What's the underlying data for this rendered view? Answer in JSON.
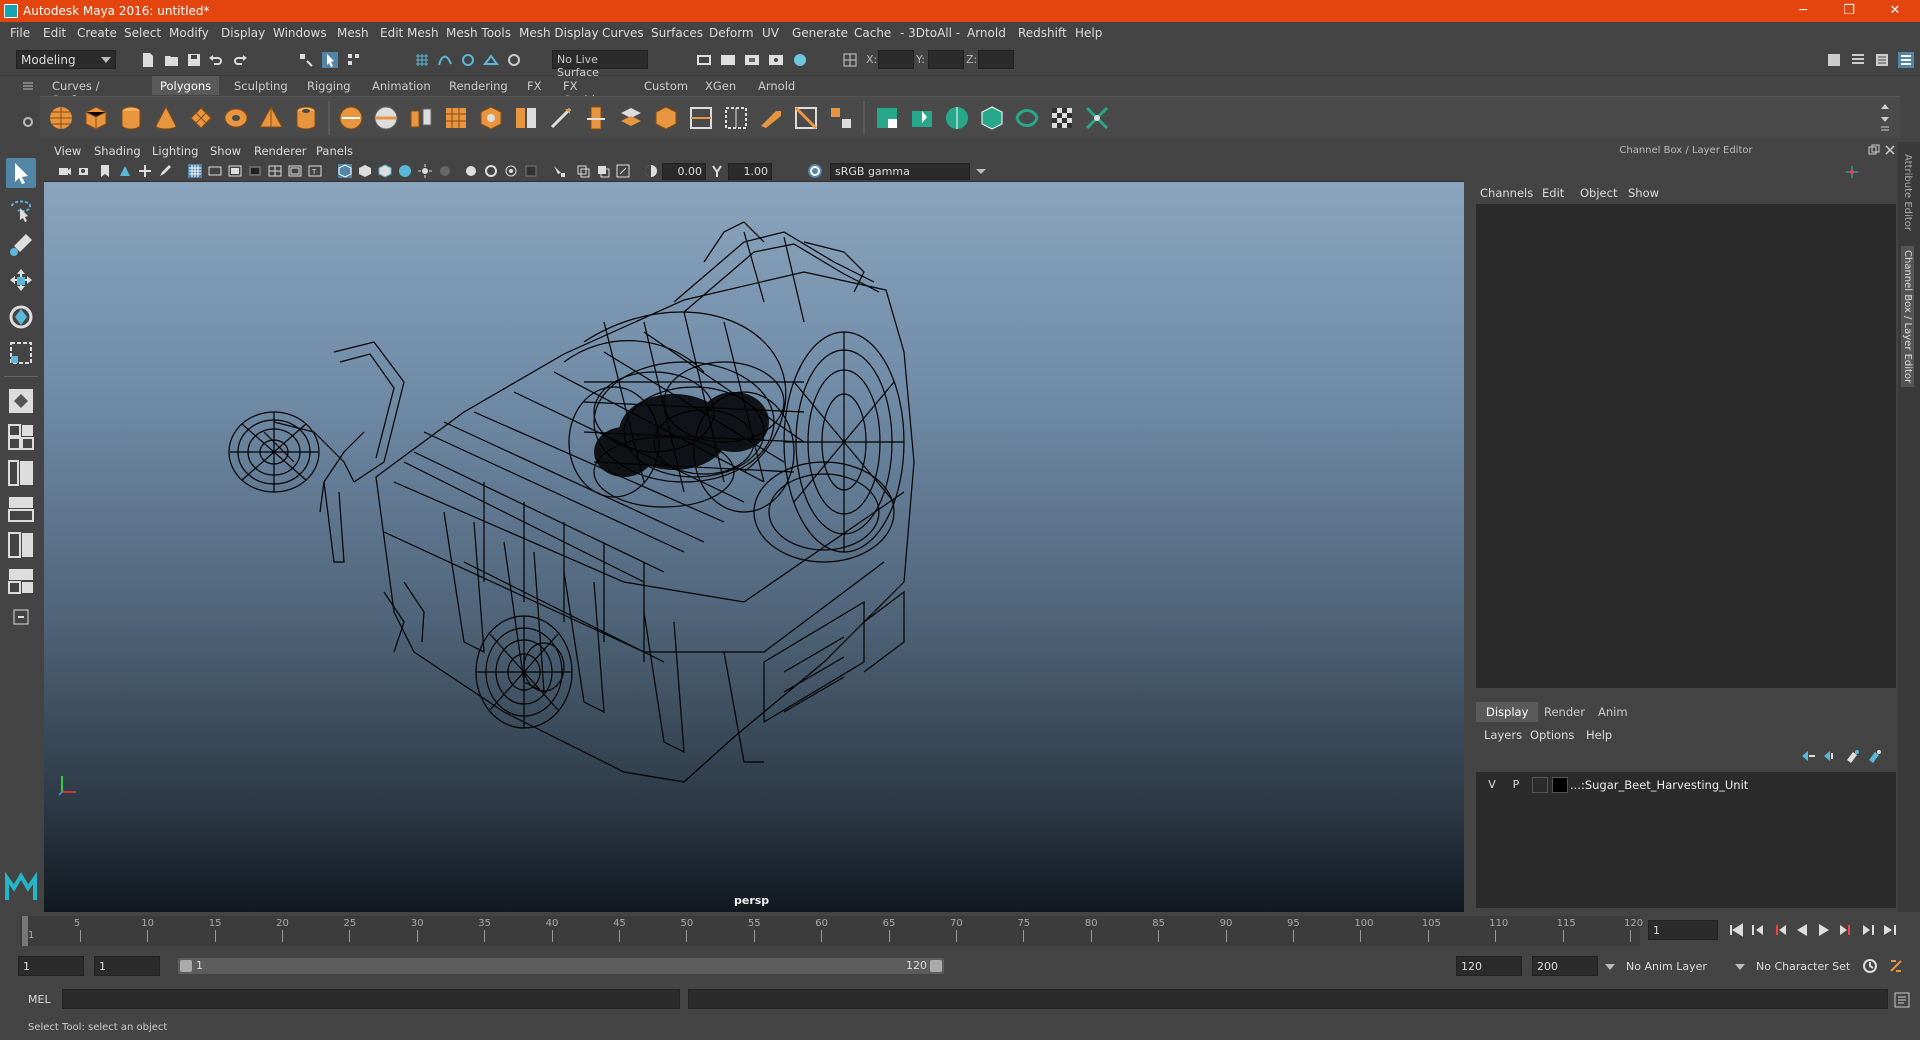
{
  "window": {
    "title": "Autodesk Maya 2016: untitled*",
    "minimize_label": "─",
    "maximize_label": "❐",
    "close_label": "✕"
  },
  "menubar": [
    "File",
    "Edit",
    "Create",
    "Select",
    "Modify",
    "Display",
    "Windows",
    "Mesh",
    "Edit Mesh",
    "Mesh Tools",
    "Mesh Display",
    "Curves",
    "Surfaces",
    "Deform",
    "UV",
    "Generate",
    "Cache",
    "- 3DtoAll -",
    "Arnold",
    "Redshift",
    "Help"
  ],
  "status_line": {
    "mode": "Modeling",
    "live_surface": "No Live Surface",
    "x_label": "X:",
    "y_label": "Y:",
    "z_label": "Z:"
  },
  "shelf": {
    "tabs": [
      "Curves / Surfaces",
      "Polygons",
      "Sculpting",
      "Rigging",
      "Animation",
      "Rendering",
      "FX",
      "FX Caching",
      "Custom",
      "XGen",
      "Arnold"
    ],
    "active_tab": "Polygons"
  },
  "viewport": {
    "menus": [
      "View",
      "Shading",
      "Lighting",
      "Show",
      "Renderer",
      "Panels"
    ],
    "exposure": "0.00",
    "gamma": "1.00",
    "color_space": "sRGB gamma",
    "camera": "persp"
  },
  "channel_box": {
    "title": "Channel Box / Layer Editor",
    "menus": [
      "Channels",
      "Edit",
      "Object",
      "Show"
    ],
    "layer_tabs": [
      "Display",
      "Render",
      "Anim"
    ],
    "active_layer_tab": "Display",
    "layer_menus": [
      "Layers",
      "Options",
      "Help"
    ],
    "layers": [
      {
        "visible": "V",
        "playback": "P",
        "name": "...:Sugar_Beet_Harvesting_Unit"
      }
    ]
  },
  "side_tabs": [
    "Attribute Editor",
    "Channel Box / Layer Editor"
  ],
  "timeline": {
    "ticks": [
      5,
      10,
      15,
      20,
      25,
      30,
      35,
      40,
      45,
      50,
      55,
      60,
      65,
      70,
      75,
      80,
      85,
      90,
      95,
      100,
      105,
      110,
      115,
      120
    ],
    "first_label": "1",
    "current_frame": "1",
    "range_min": 1,
    "range_max": 120
  },
  "range": {
    "start": "1",
    "playback_start": "1",
    "inner_start": "1",
    "inner_end": "120",
    "playback_end": "120",
    "end": "200",
    "anim_layer": "No Anim Layer",
    "character_set": "No Character Set"
  },
  "command": {
    "label": "MEL"
  },
  "help_line": "Select Tool: select an object",
  "colors": {
    "title_bar": "#e4450e",
    "ui_bg": "#444444",
    "field_bg": "#2b2b2b",
    "active_tool": "#5285a6",
    "shelf_orange": "#e89540",
    "shelf_green": "#28a88a",
    "wire": "#000000"
  }
}
